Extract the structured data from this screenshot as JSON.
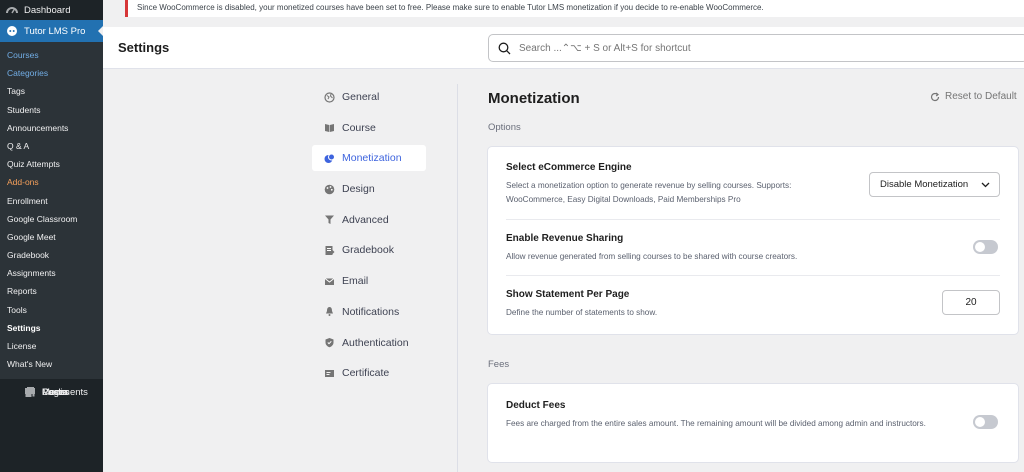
{
  "notice": {
    "text": "Since WooCommerce is disabled, your monetized courses have been set to free. Please make sure to enable Tutor LMS monetization if you decide to re-enable WooCommerce."
  },
  "wp_sidebar": {
    "dashboard": "Dashboard",
    "plugin": "Tutor LMS Pro",
    "submenu": [
      {
        "label": "Courses",
        "style": "blue"
      },
      {
        "label": "Categories",
        "style": "blue"
      },
      {
        "label": "Tags",
        "style": ""
      },
      {
        "label": "Students",
        "style": ""
      },
      {
        "label": "Announcements",
        "style": ""
      },
      {
        "label": "Q & A",
        "style": ""
      },
      {
        "label": "Quiz Attempts",
        "style": ""
      },
      {
        "label": "Add-ons",
        "style": "orange"
      },
      {
        "label": "Enrollment",
        "style": ""
      },
      {
        "label": "Google Classroom",
        "style": ""
      },
      {
        "label": "Google Meet",
        "style": ""
      },
      {
        "label": "Gradebook",
        "style": ""
      },
      {
        "label": "Assignments",
        "style": ""
      },
      {
        "label": "Reports",
        "style": ""
      },
      {
        "label": "Tools",
        "style": ""
      },
      {
        "label": "Settings",
        "style": "bold"
      },
      {
        "label": "License",
        "style": ""
      },
      {
        "label": "What's New",
        "style": ""
      }
    ],
    "bottom": [
      {
        "label": "Posts",
        "icon": "pin-icon"
      },
      {
        "label": "Media",
        "icon": "media-icon"
      },
      {
        "label": "Pages",
        "icon": "pages-icon"
      },
      {
        "label": "Comments",
        "icon": "comments-icon"
      }
    ]
  },
  "header": {
    "title": "Settings",
    "search_placeholder": "Search ...⌃⌥ + S or Alt+S for shortcut"
  },
  "settings_nav": [
    {
      "label": "General",
      "icon": "globe-icon",
      "active": false
    },
    {
      "label": "Course",
      "icon": "book-icon",
      "active": false
    },
    {
      "label": "Monetization",
      "icon": "monetization-icon",
      "active": true
    },
    {
      "label": "Design",
      "icon": "palette-icon",
      "active": false
    },
    {
      "label": "Advanced",
      "icon": "filter-icon",
      "active": false
    },
    {
      "label": "Gradebook",
      "icon": "gradebook-icon",
      "active": false
    },
    {
      "label": "Email",
      "icon": "email-icon",
      "active": false
    },
    {
      "label": "Notifications",
      "icon": "bell-icon",
      "active": false
    },
    {
      "label": "Authentication",
      "icon": "shield-icon",
      "active": false
    },
    {
      "label": "Certificate",
      "icon": "certificate-icon",
      "active": false
    }
  ],
  "main": {
    "title": "Monetization",
    "reset_label": "Reset to Default",
    "options_label": "Options",
    "fees_label": "Fees",
    "ecommerce": {
      "title": "Select eCommerce Engine",
      "desc": "Select a monetization option to generate revenue by selling courses. Supports: WooCommerce, Easy Digital Downloads, Paid Memberships Pro",
      "selected": "Disable Monetization"
    },
    "revenue": {
      "title": "Enable Revenue Sharing",
      "desc": "Allow revenue generated from selling courses to be shared with course creators.",
      "enabled": false
    },
    "statement": {
      "title": "Show Statement Per Page",
      "desc": "Define the number of statements to show.",
      "value": "20"
    },
    "deduct": {
      "title": "Deduct Fees",
      "desc": "Fees are charged from the entire sales amount. The remaining amount will be divided among admin and instructors.",
      "enabled": false
    }
  },
  "colors": {
    "wp_dark": "#1d2327",
    "wp_blue": "#2271b1",
    "tutor_blue": "#3e64de",
    "toggle_off": "#c6c9d0"
  }
}
